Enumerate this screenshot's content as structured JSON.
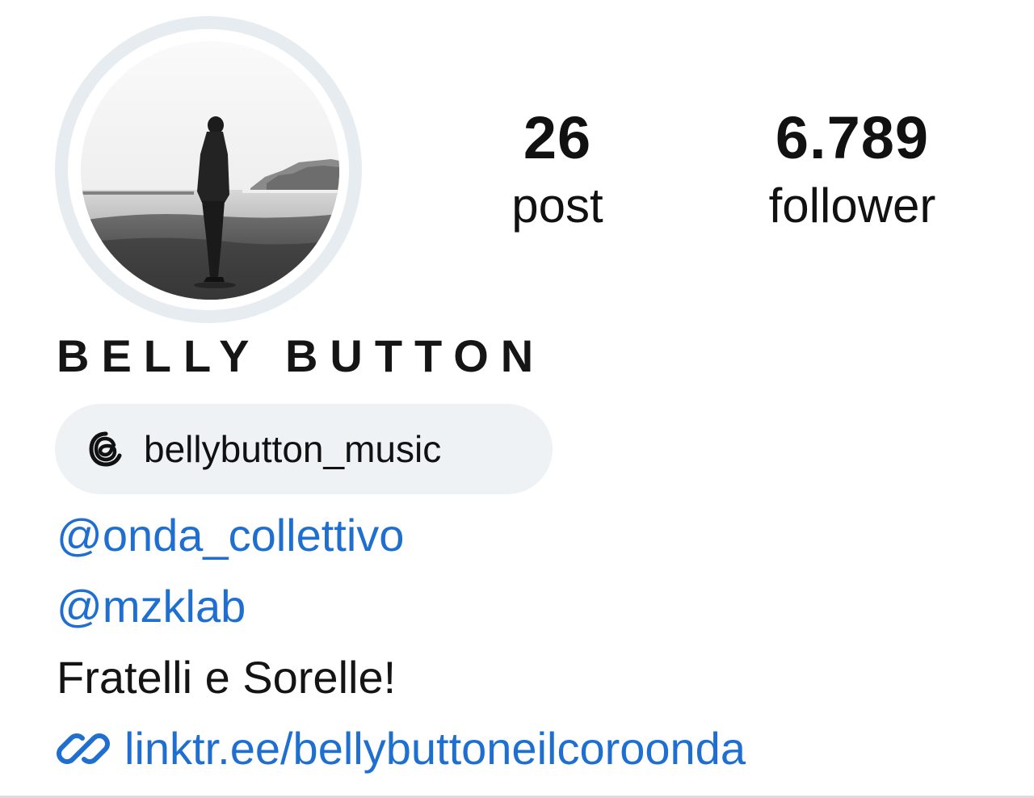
{
  "profile": {
    "display_name": "BELLY BUTTON",
    "avatar_icon": "profile-photo",
    "stats": {
      "posts_value": "26",
      "posts_label": "post",
      "followers_value": "6.789",
      "followers_label": "follower"
    },
    "threads": {
      "icon": "threads-icon",
      "handle": "bellybutton_music"
    },
    "bio": {
      "mentions": [
        "@onda_collettivo",
        "@mzklab"
      ],
      "text": "Fratelli e Sorelle!"
    },
    "link": {
      "icon": "link-icon",
      "label": "linktr.ee/bellybuttoneilcoroonda"
    }
  },
  "colors": {
    "link_blue": "#1e6fd0",
    "pill_bg": "#eff2f5",
    "ring": "#e7ecf1",
    "text": "#111111"
  }
}
